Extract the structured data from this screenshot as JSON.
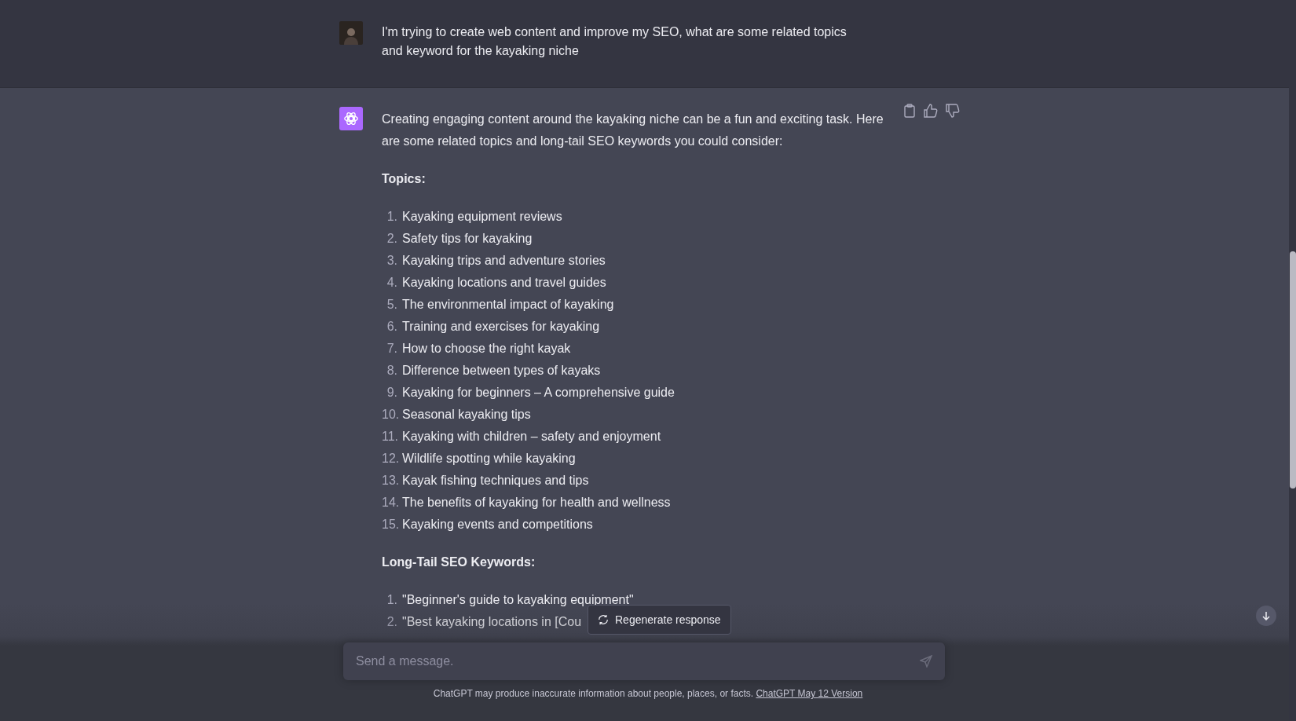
{
  "user_message": {
    "text": "I'm trying to create web content and improve my SEO, what are some related topics and keyword for the kayaking niche"
  },
  "assistant_message": {
    "intro": "Creating engaging content around the kayaking niche can be a fun and exciting task. Here are some related topics and long-tail SEO keywords you could consider:",
    "sections": [
      {
        "heading": "Topics:",
        "items": [
          {
            "number": "1.",
            "text": "Kayaking equipment reviews"
          },
          {
            "number": "2.",
            "text": "Safety tips for kayaking"
          },
          {
            "number": "3.",
            "text": "Kayaking trips and adventure stories"
          },
          {
            "number": "4.",
            "text": "Kayaking locations and travel guides"
          },
          {
            "number": "5.",
            "text": "The environmental impact of kayaking"
          },
          {
            "number": "6.",
            "text": "Training and exercises for kayaking"
          },
          {
            "number": "7.",
            "text": "How to choose the right kayak"
          },
          {
            "number": "8.",
            "text": "Difference between types of kayaks"
          },
          {
            "number": "9.",
            "text": "Kayaking for beginners – A comprehensive guide"
          },
          {
            "number": "10.",
            "text": "Seasonal kayaking tips"
          },
          {
            "number": "11.",
            "text": "Kayaking with children – safety and enjoyment"
          },
          {
            "number": "12.",
            "text": "Wildlife spotting while kayaking"
          },
          {
            "number": "13.",
            "text": "Kayak fishing techniques and tips"
          },
          {
            "number": "14.",
            "text": "The benefits of kayaking for health and wellness"
          },
          {
            "number": "15.",
            "text": "Kayaking events and competitions"
          }
        ]
      },
      {
        "heading": "Long-Tail SEO Keywords:",
        "items": [
          {
            "number": "1.",
            "text": "\"Beginner's guide to kayaking equipment\""
          },
          {
            "number": "2.",
            "text": "\"Best kayaking locations in [Cou"
          }
        ]
      }
    ]
  },
  "regenerate_button": {
    "label": "Regenerate response"
  },
  "message_input": {
    "placeholder": "Send a message."
  },
  "footer": {
    "text": "ChatGPT may produce inaccurate information about people, places, or facts.",
    "link": "ChatGPT May 12 Version"
  }
}
